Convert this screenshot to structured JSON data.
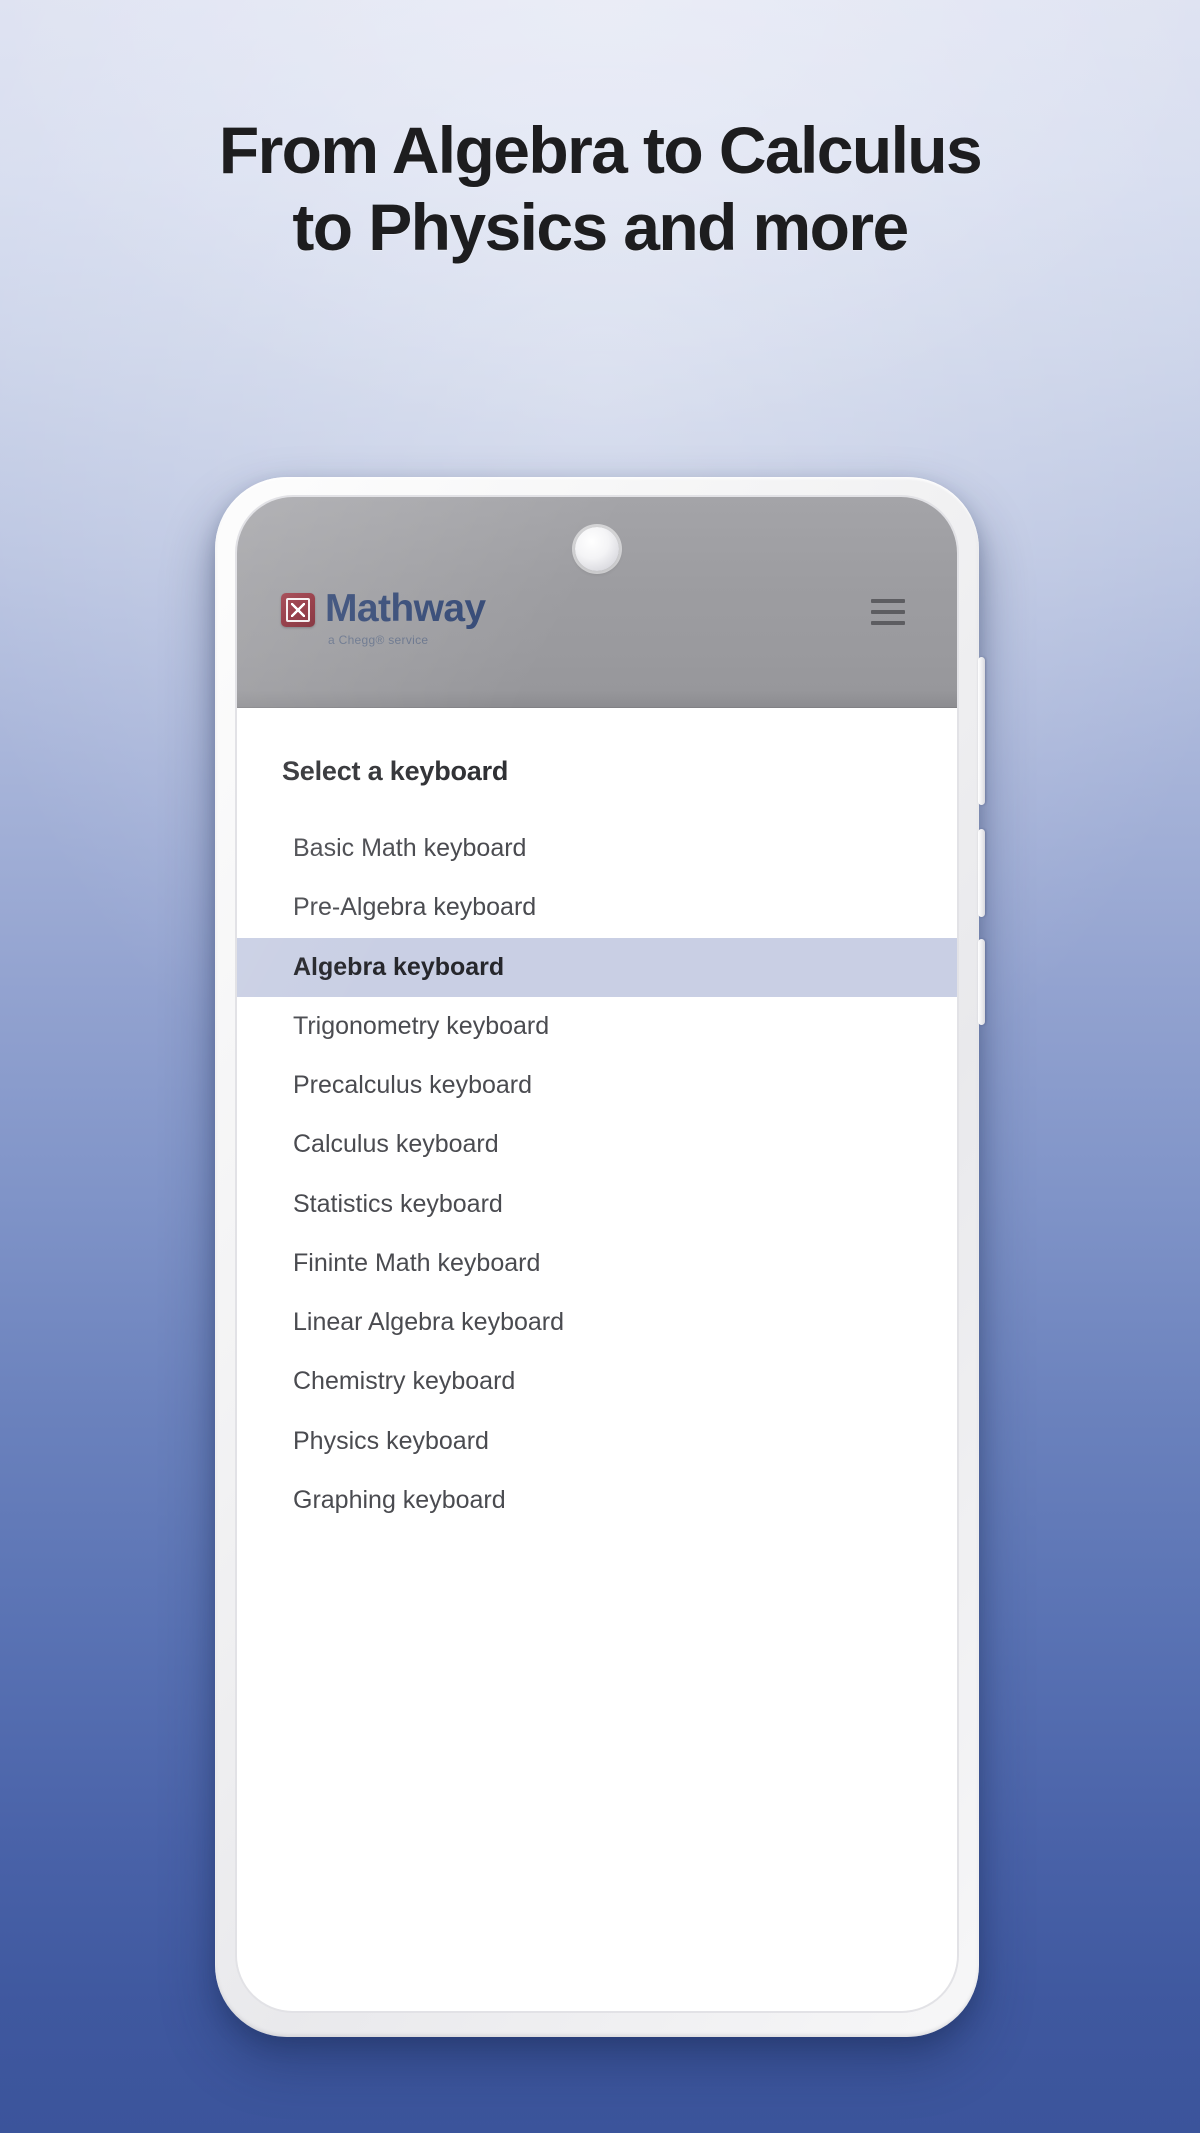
{
  "background": {
    "gradient_top": "#dfe3f2",
    "gradient_mid": "#8094c8",
    "gradient_bottom": "#3b549b"
  },
  "headline": {
    "line1": "From Algebra to Calculus",
    "line2": "to Physics and more",
    "color": "#1d1d1f"
  },
  "phone": {
    "app_header": {
      "logo_word": "Mathway",
      "logo_subtitle": "a Chegg® service",
      "logo_mark_color": "#8d2b37",
      "logo_text_color": "#2d4372",
      "menu_icon": "hamburger-icon",
      "camera_icon": "front-camera",
      "speaker_icon": "earpiece-speaker",
      "header_bg": "#9a9a9e"
    },
    "screen": {
      "section_title": "Select a keyboard",
      "selected_highlight_color": "#c9cfe4",
      "keyboards": [
        {
          "label": "Basic Math keyboard",
          "selected": false
        },
        {
          "label": "Pre-Algebra keyboard",
          "selected": false
        },
        {
          "label": "Algebra keyboard",
          "selected": true
        },
        {
          "label": "Trigonometry keyboard",
          "selected": false
        },
        {
          "label": "Precalculus keyboard",
          "selected": false
        },
        {
          "label": "Calculus keyboard",
          "selected": false
        },
        {
          "label": "Statistics keyboard",
          "selected": false
        },
        {
          "label": "Fininte Math keyboard",
          "selected": false
        },
        {
          "label": "Linear Algebra keyboard",
          "selected": false
        },
        {
          "label": "Chemistry keyboard",
          "selected": false
        },
        {
          "label": "Physics keyboard",
          "selected": false
        },
        {
          "label": "Graphing keyboard",
          "selected": false
        }
      ]
    },
    "hardware": {
      "side_buttons": [
        "volume-up-button",
        "volume-down-button",
        "power-button"
      ]
    }
  }
}
